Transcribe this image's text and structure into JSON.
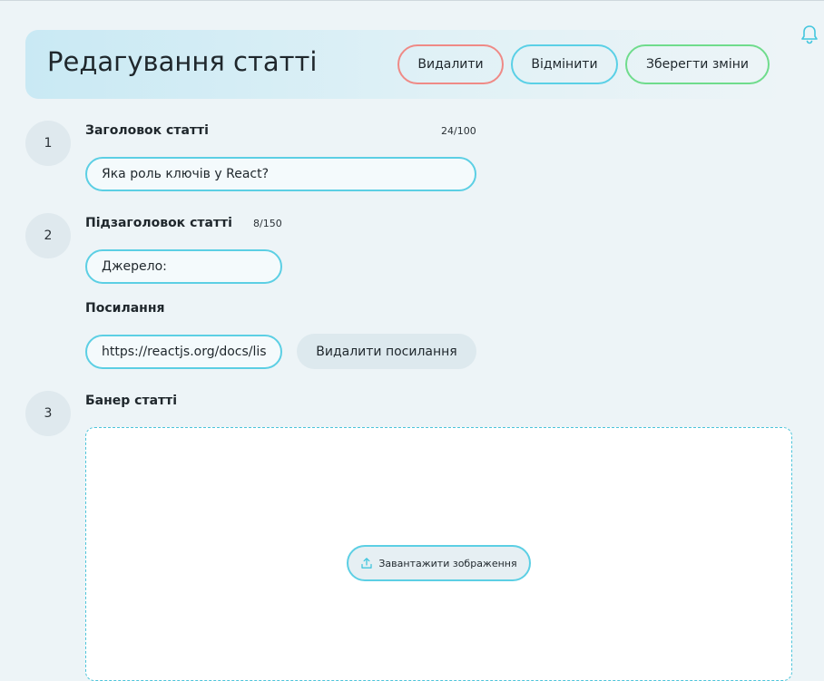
{
  "header": {
    "title": "Редагування статті",
    "delete_label": "Видалити",
    "cancel_label": "Відмінити",
    "save_label": "Зберегти зміни"
  },
  "icons": {
    "notifications": "bell-icon",
    "upload": "upload-icon"
  },
  "colors": {
    "accent": "#5ccfe4",
    "delete_border": "#ef8a86",
    "save_border": "#6fdc8c",
    "background": "#edf4f7"
  },
  "steps": {
    "one": "1",
    "two": "2",
    "three": "3"
  },
  "title_field": {
    "label": "Заголовок статті",
    "counter": "24/100",
    "value": "Яка роль ключів у React?"
  },
  "subtitle_field": {
    "label": "Підзаголовок статті",
    "counter": "8/150",
    "value": "Джерело:"
  },
  "link_field": {
    "label": "Посилання",
    "value": "https://reactjs.org/docs/lists-and-keys.html",
    "remove_label": "Видалити посилання"
  },
  "banner": {
    "label": "Банер статті",
    "upload_label": "Завантажити зображення"
  }
}
